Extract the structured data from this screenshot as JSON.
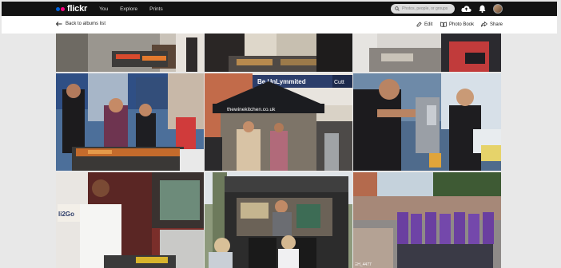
{
  "brand": {
    "name": "flickr",
    "blue": "#0063dc",
    "pink": "#ff0084"
  },
  "nav": {
    "links": [
      "You",
      "Explore",
      "Prints"
    ],
    "search_placeholder": "Photos, people, or groups",
    "icons": [
      "upload-cloud-icon",
      "bell-icon",
      "avatar"
    ]
  },
  "toolbar": {
    "back_label": "Back to albums list",
    "edit_label": "Edit",
    "photobook_label": "Photo Book",
    "share_label": "Share"
  },
  "photos": {
    "r2c2_sign": "Be UnLymmited",
    "r2c2_canopy": "thewinekitchen.co.uk",
    "r2c2_cutt": "Cutt",
    "r3c1_sign": "li2Go",
    "r3c3_caption": "ΞH_4477"
  }
}
